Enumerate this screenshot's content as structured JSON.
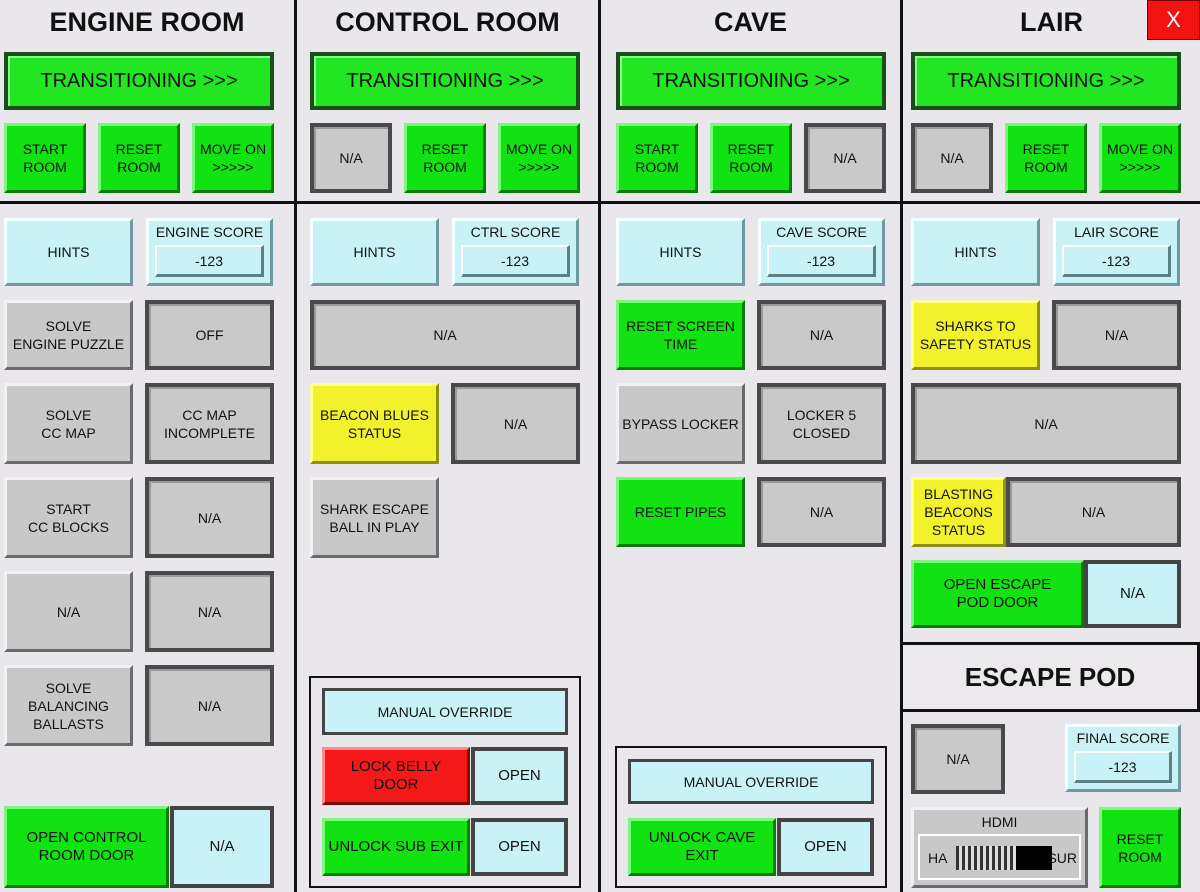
{
  "window": {
    "close_label": "X"
  },
  "engine": {
    "title": "ENGINE ROOM",
    "status": "TRANSITIONING >>>",
    "start": "START\nROOM",
    "reset": "RESET\nROOM",
    "move_on": "MOVE ON\n>>>>>",
    "hints": "HINTS",
    "score_label": "ENGINE SCORE",
    "score_value": "-123",
    "solve_engine": "SOLVE\nENGINE PUZZLE",
    "solve_engine_state": "OFF",
    "solve_cc_map": "SOLVE\nCC MAP",
    "cc_map_state": "CC MAP\nINCOMPLETE",
    "start_cc_blocks": "START\nCC BLOCKS",
    "cc_blocks_state": "N/A",
    "na_btn": "N/A",
    "na_state": "N/A",
    "solve_ballasts": "SOLVE\nBALANCING\nBALLASTS",
    "ballasts_state": "N/A",
    "open_control": "OPEN CONTROL\nROOM DOOR",
    "open_control_state": "N/A"
  },
  "control": {
    "title": "CONTROL ROOM",
    "status": "TRANSITIONING >>>",
    "start": "N/A",
    "reset": "RESET\nROOM",
    "move_on": "MOVE ON\n>>>>>",
    "hints": "HINTS",
    "score_label": "CTRL SCORE",
    "score_value": "-123",
    "wide_state": "N/A",
    "beacon_blues": "BEACON BLUES\nSTATUS",
    "beacon_state": "N/A",
    "shark_escape": "SHARK ESCAPE\nBALL IN PLAY",
    "manual_override": "MANUAL OVERRIDE",
    "lock_belly": "LOCK BELLY\nDOOR",
    "lock_belly_state": "OPEN",
    "unlock_sub": "UNLOCK SUB EXIT",
    "unlock_sub_state": "OPEN"
  },
  "cave": {
    "title": "CAVE",
    "status": "TRANSITIONING >>>",
    "start": "START\nROOM",
    "reset": "RESET\nROOM",
    "move_on": "N/A",
    "hints": "HINTS",
    "score_label": "CAVE SCORE",
    "score_value": "-123",
    "reset_screen": "RESET SCREEN\nTIME",
    "reset_screen_state": "N/A",
    "bypass_locker": "BYPASS LOCKER",
    "locker_state": "LOCKER 5\nCLOSED",
    "reset_pipes": "RESET PIPES",
    "pipes_state": "N/A",
    "manual_override": "MANUAL OVERRIDE",
    "unlock_cave": "UNLOCK CAVE\nEXIT",
    "unlock_cave_state": "OPEN"
  },
  "lair": {
    "title": "LAIR",
    "status": "TRANSITIONING >>>",
    "start": "N/A",
    "reset": "RESET\nROOM",
    "move_on": "MOVE ON\n>>>>>",
    "hints": "HINTS",
    "score_label": "LAIR SCORE",
    "score_value": "-123",
    "sharks": "SHARKS TO\nSAFETY STATUS",
    "sharks_state": "N/A",
    "wide_state": "N/A",
    "blasting": "BLASTING\nBEACONS\nSTATUS",
    "blasting_state": "N/A",
    "open_pod": "OPEN ESCAPE\nPOD DOOR",
    "open_pod_state": "N/A"
  },
  "escape_pod": {
    "title": "ESCAPE POD",
    "na_btn": "N/A",
    "score_label": "FINAL SCORE",
    "score_value": "-123",
    "hdmi_label": "HDMI",
    "hdmi_left": "HA",
    "hdmi_right": "SUR",
    "reset": "RESET\nROOM"
  },
  "colors": {
    "green": "#11e211",
    "gray": "#c8c8c8",
    "cyan": "#c8f2f6",
    "yellow": "#f2f22c",
    "red": "#f41818",
    "background": "#e9e7eb"
  }
}
